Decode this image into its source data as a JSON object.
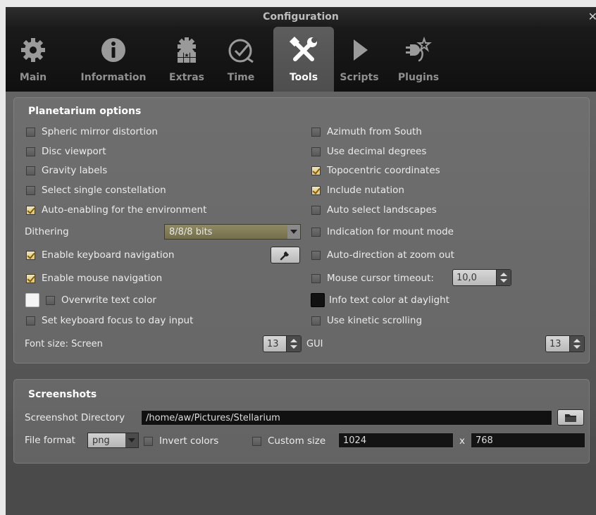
{
  "window": {
    "title": "Configuration",
    "close_glyph": "✕"
  },
  "tabs": [
    {
      "label": "Main",
      "icon": "gear-icon"
    },
    {
      "label": "Information",
      "icon": "info-icon"
    },
    {
      "label": "Extras",
      "icon": "extras-icon"
    },
    {
      "label": "Time",
      "icon": "clock-icon"
    },
    {
      "label": "Tools",
      "icon": "tools-icon",
      "active": true
    },
    {
      "label": "Scripts",
      "icon": "play-icon"
    },
    {
      "label": "Plugins",
      "icon": "plugin-icon"
    }
  ],
  "planetarium": {
    "title": "Planetarium options",
    "left": [
      {
        "label": "Spheric mirror distortion",
        "checked": false
      },
      {
        "label": "Disc viewport",
        "checked": false
      },
      {
        "label": "Gravity labels",
        "checked": false
      },
      {
        "label": "Select single constellation",
        "checked": false
      },
      {
        "label": "Auto-enabling for the environment",
        "checked": true
      }
    ],
    "right": [
      {
        "label": "Azimuth from South",
        "checked": false
      },
      {
        "label": "Use decimal degrees",
        "checked": false
      },
      {
        "label": "Topocentric coordinates",
        "checked": true
      },
      {
        "label": "Include nutation",
        "checked": true
      },
      {
        "label": "Auto select landscapes",
        "checked": false
      }
    ],
    "dithering_label": "Dithering",
    "dithering_value": "8/8/8 bits",
    "mount_mode_label": "Indication for mount mode",
    "keyboard_nav_label": "Enable keyboard navigation",
    "auto_direction_label": "Auto-direction at zoom out",
    "mouse_nav_label": "Enable mouse navigation",
    "mouse_timeout_label": "Mouse cursor timeout:",
    "mouse_timeout_value": "10,0",
    "overwrite_color_label": "Overwrite text color",
    "overwrite_color_swatch": "#f4f4f4",
    "daylight_color_label": "Info text color at daylight",
    "daylight_color_swatch": "#111111",
    "keyboard_focus_label": "Set keyboard focus to day input",
    "kinetic_label": "Use kinetic scrolling",
    "font_screen_label": "Font size: Screen",
    "font_screen_value": "13",
    "font_gui_label": "GUI",
    "font_gui_value": "13"
  },
  "screenshots": {
    "title": "Screenshots",
    "dir_label": "Screenshot Directory",
    "dir_value": "/home/aw/Pictures/Stellarium",
    "format_label": "File format",
    "format_value": "png",
    "invert_label": "Invert colors",
    "custom_size_label": "Custom size",
    "width_value": "1024",
    "x_label": "x",
    "height_value": "768"
  },
  "colors": {
    "accent_checked": "#d8c580",
    "panel_bg": "#6f6f6f",
    "toolbar_bg": "#141414"
  }
}
